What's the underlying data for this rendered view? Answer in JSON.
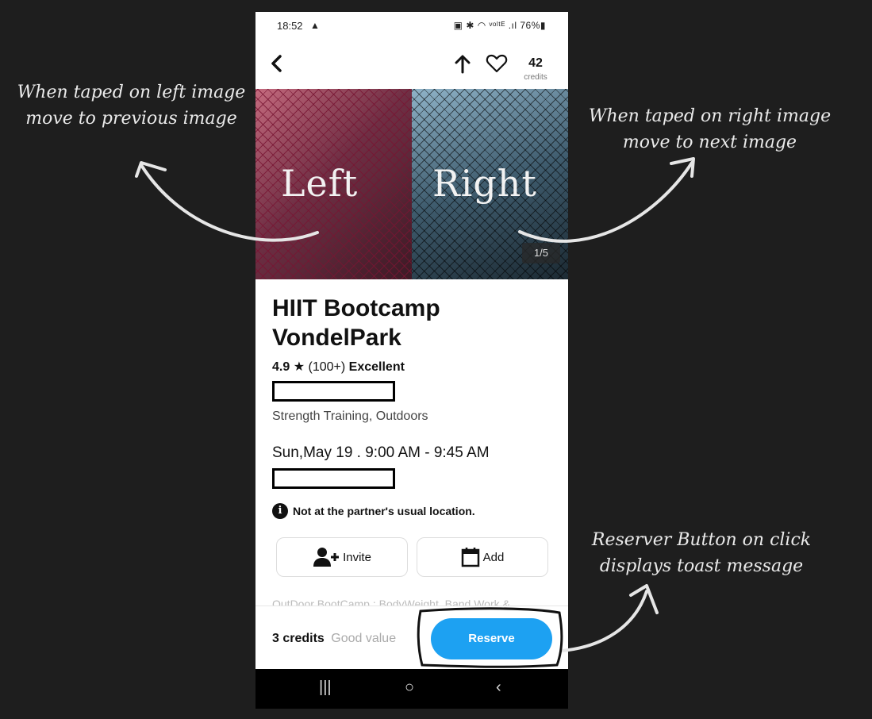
{
  "status_bar": {
    "time": "18:52",
    "warning": "▲",
    "system": "▣ ✱ ◠ ᵛᵒˡᵗᴱ .ıl 76%▮"
  },
  "header": {
    "back": "‹",
    "credits_count": "42",
    "credits_label": "credits"
  },
  "gallery": {
    "left_label": "Left",
    "right_label": "Right",
    "counter": "1/5"
  },
  "class_info": {
    "title": "HIIT Bootcamp VondelPark",
    "rating": "4.9",
    "star": "★",
    "reviews": "(100+)",
    "rating_word": "Excellent",
    "tags": "Strength Training, Outdoors",
    "schedule": "Sun,May 19 . 9:00 AM - 9:45 AM",
    "notice": "Not at the partner's usual location.",
    "info_icon": "i",
    "description_preview": "OutDoor BootCamp : BodyWeight, Band Work &"
  },
  "actions": {
    "invite_label": "Invite",
    "add_label": "Add"
  },
  "footer": {
    "price": "3 credits",
    "value_note": "Good value",
    "reserve_label": "Reserve"
  },
  "nav": {
    "recents": "|||",
    "home": "○",
    "back": "‹"
  },
  "annotations": {
    "left": "When taped on left image move to previous image",
    "right": "When taped on right image move to next image",
    "reserve": "Reserver Button on click displays toast message"
  },
  "colors": {
    "accent": "#1da1f2",
    "background": "#1e1e1e"
  }
}
